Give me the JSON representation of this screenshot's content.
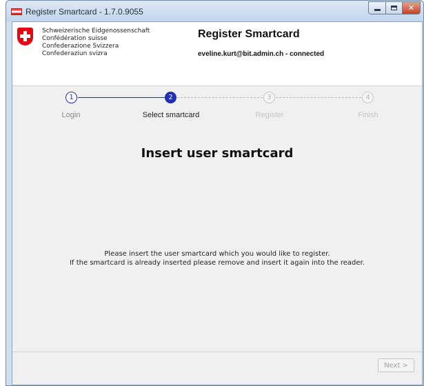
{
  "window": {
    "title": "Register Smartcard - 1.7.0.9055",
    "close_glyph": "✕"
  },
  "header": {
    "org_lines": [
      "Schweizerische Eidgenossenschaft",
      "Confédération suisse",
      "Confederazione Svizzera",
      "Confederaziun svizra"
    ],
    "app_title": "Register Smartcard",
    "user_status": "eveline.kurt@bit.admin.ch - connected"
  },
  "steps": [
    {
      "number": "1",
      "label": "Login",
      "state": "done"
    },
    {
      "number": "2",
      "label": "Select smartcard",
      "state": "active"
    },
    {
      "number": "3",
      "label": "Register",
      "state": "pending"
    },
    {
      "number": "4",
      "label": "Finish",
      "state": "pending"
    }
  ],
  "main": {
    "heading": "Insert user smartcard",
    "message_lines": [
      "Please insert the user smartcard which you would like to register.",
      "If the smartcard is already inserted please remove and insert it again into the reader."
    ]
  },
  "footer": {
    "next_label": "Next >",
    "next_enabled": false
  },
  "colors": {
    "accent": "#1f2fb3",
    "flag_red": "#e30613"
  },
  "icons": {
    "app": "swiss-flag-app-icon",
    "logo": "swiss-cross-logo"
  }
}
